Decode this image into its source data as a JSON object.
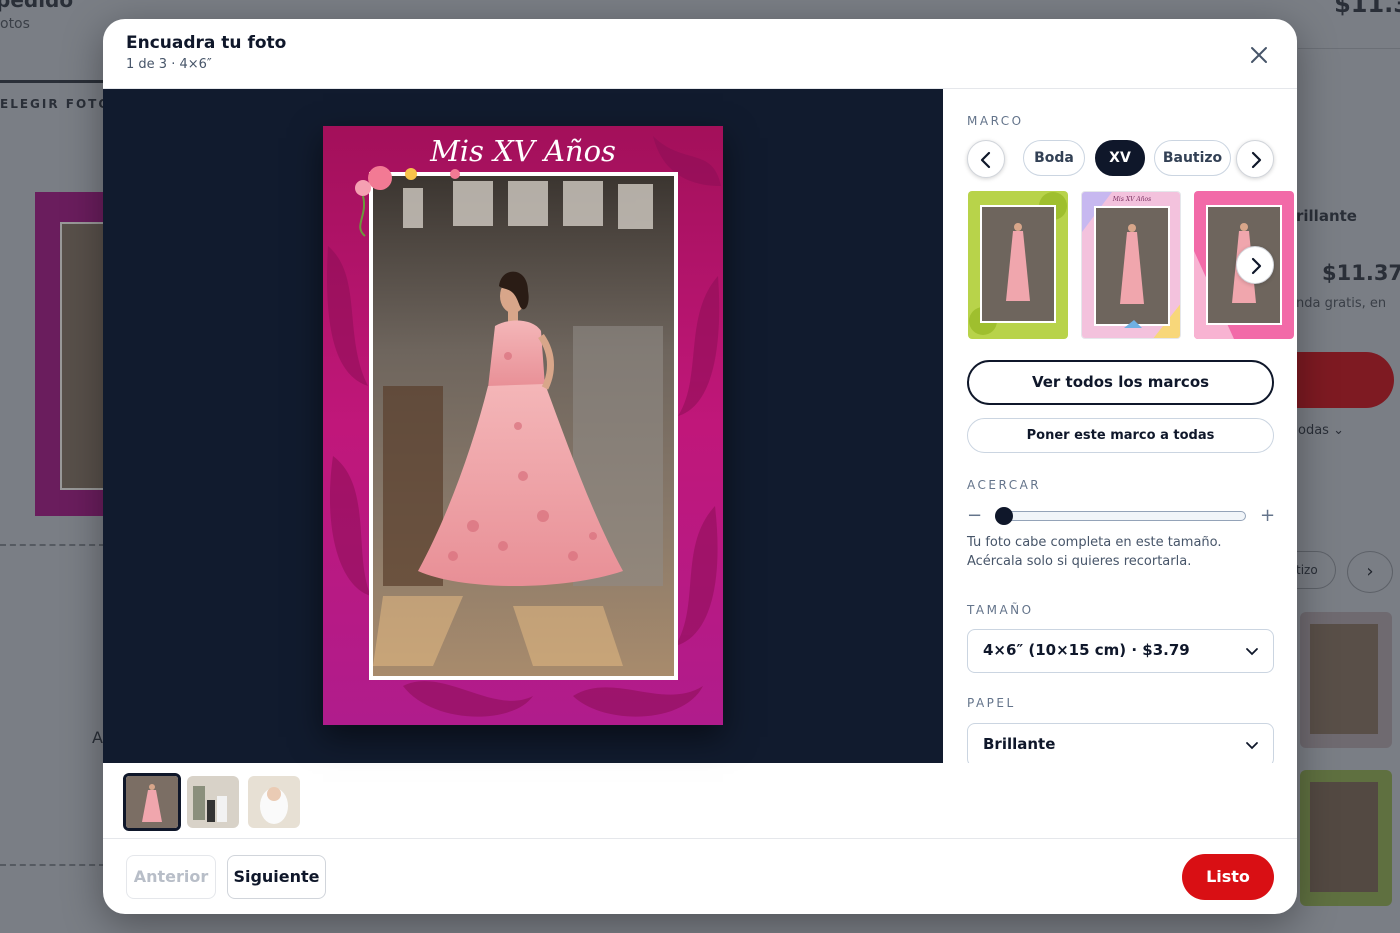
{
  "background": {
    "title": "pedido",
    "subtitle": "otos",
    "price_top": "$11.3",
    "step_label": "ELEGIR FOTOS",
    "letter": "A",
    "right_paper": "rillante",
    "right_price": "$11.37",
    "right_note": "nda gratis, en",
    "right_todas": "odas",
    "right_pill": "tizo"
  },
  "modal": {
    "title": "Encuadra tu foto",
    "subtitle": "1 de 3 · 4×6″",
    "close_label": "×"
  },
  "photo": {
    "frame_caption": "Mis XV Años"
  },
  "sidebar": {
    "marco": {
      "label": "MARCO",
      "chips": [
        "Boda",
        "XV",
        "Bautizo"
      ],
      "active_chip": "XV",
      "thumb_caption": "Mis XV Años",
      "btn_all_frames": "Ver todos los marcos",
      "btn_apply_all": "Poner este marco a todas"
    },
    "acercar": {
      "label": "ACERCAR",
      "minus": "−",
      "plus": "+",
      "zoom_fraction": 0.0,
      "hint": "Tu foto cabe completa en este tamaño. Acércala solo si quieres recortarla."
    },
    "tamano": {
      "label": "TAMAÑO",
      "value": "4×6″ (10×15 cm) · $3.79"
    },
    "papel": {
      "label": "PAPEL",
      "value": "Brillante"
    }
  },
  "footer": {
    "prev": "Anterior",
    "next": "Siguiente",
    "done": "Listo"
  },
  "colors": {
    "accent_red": "#d90f14",
    "dark": "#0f172a",
    "stage_bg": "#111b2e",
    "frame_magenta": "#c0177a"
  }
}
